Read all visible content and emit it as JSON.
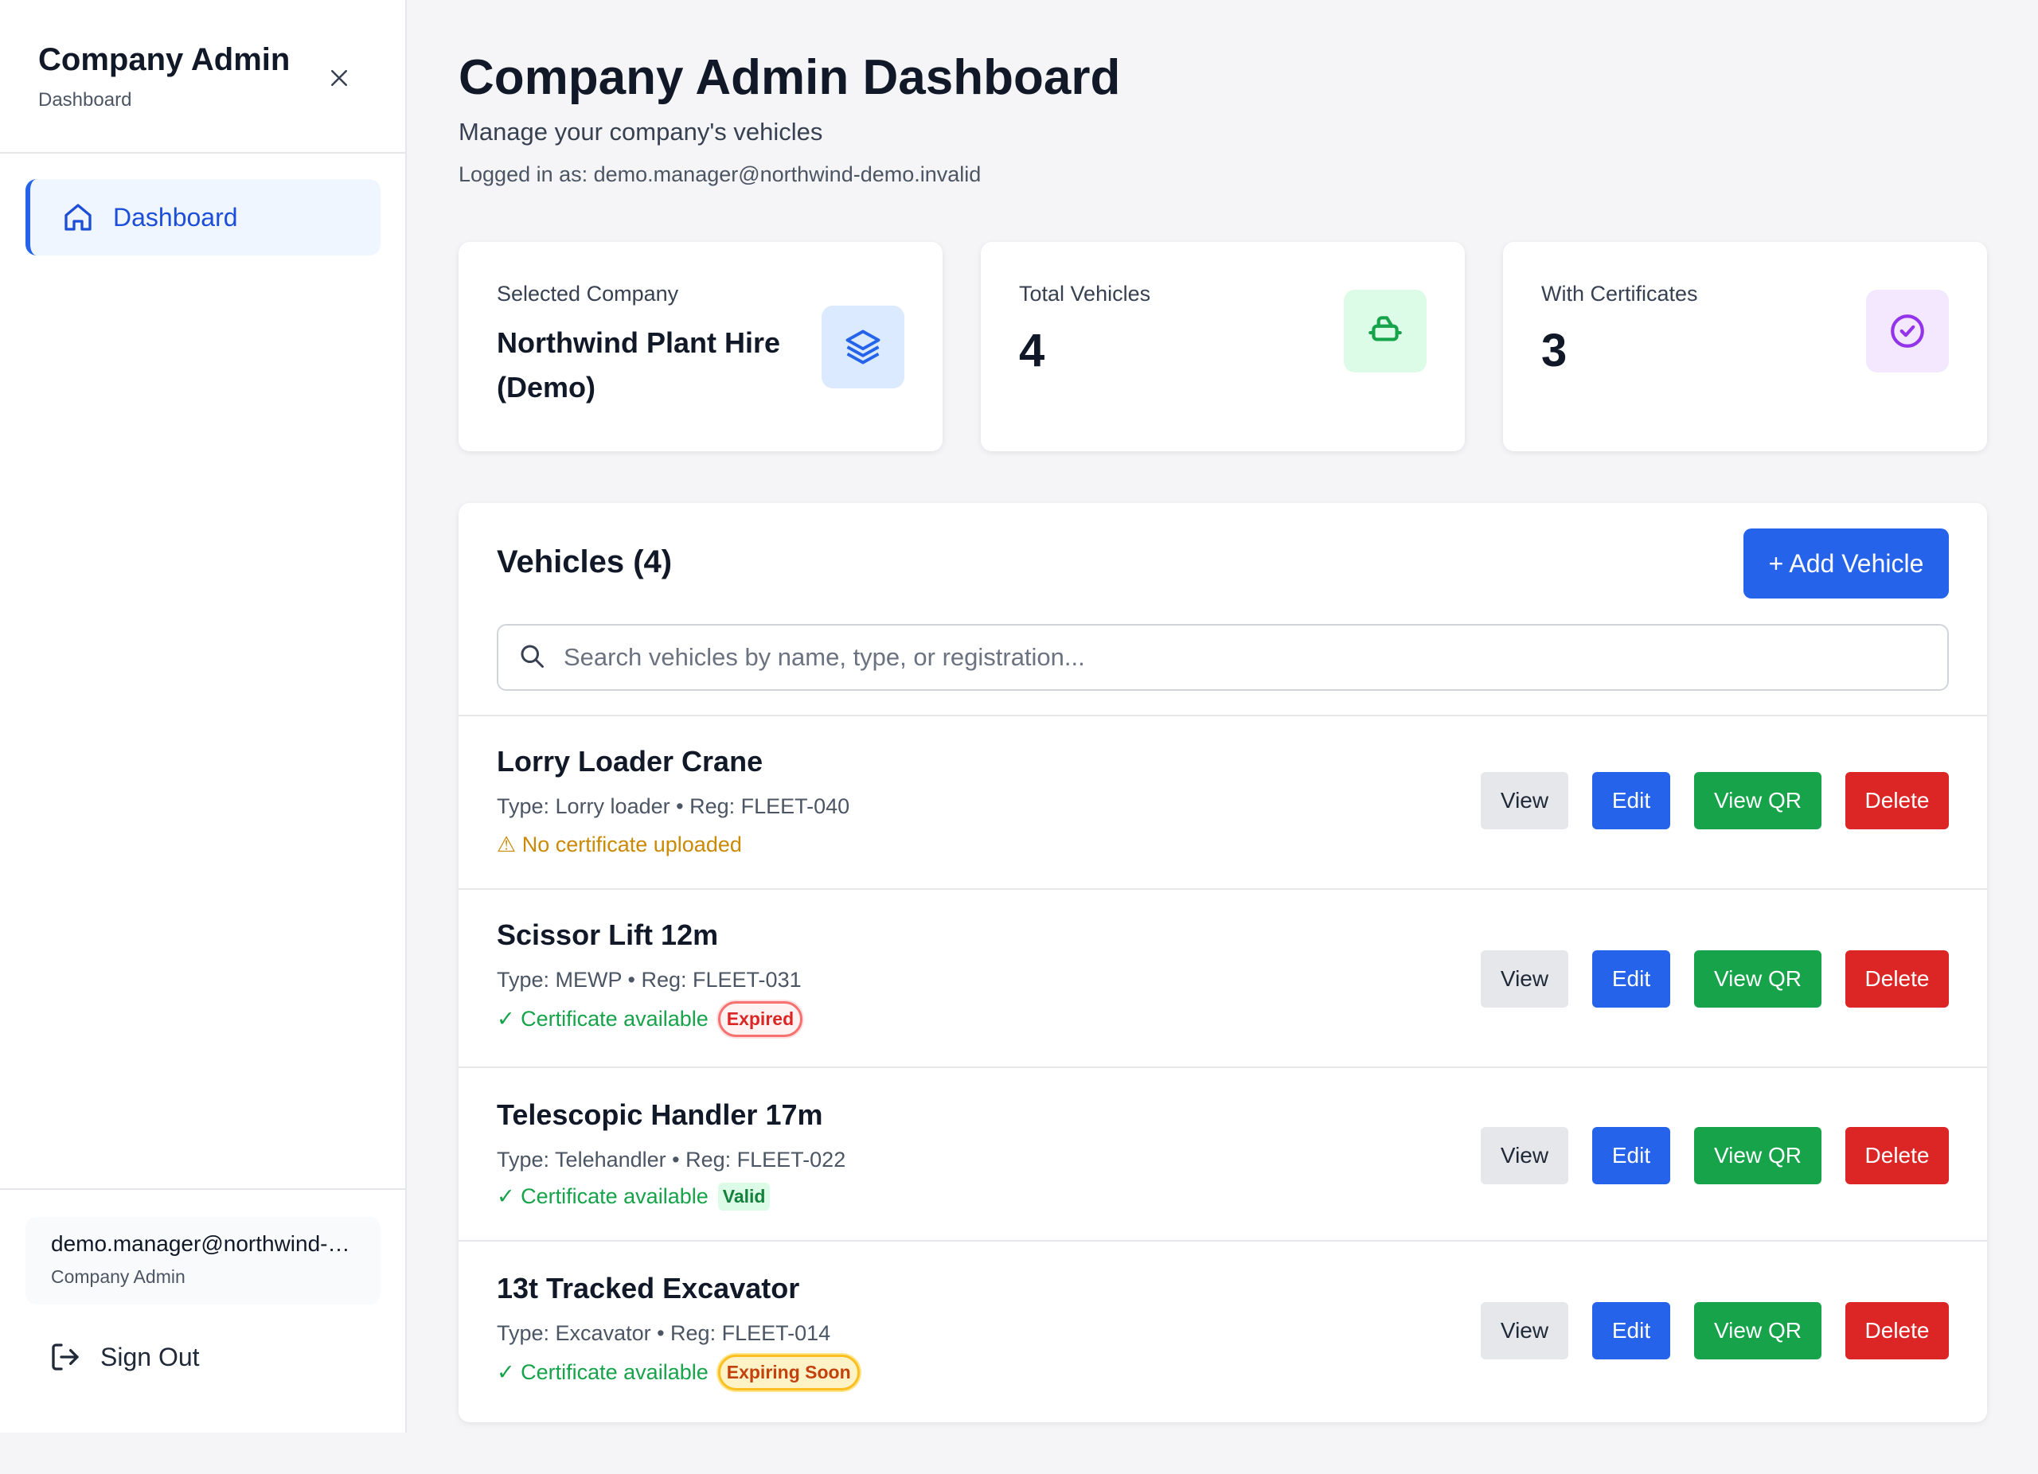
{
  "sidebar": {
    "title": "Company Admin",
    "subtitle": "Dashboard",
    "nav": [
      {
        "label": "Dashboard",
        "icon": "home-icon"
      }
    ],
    "user": {
      "email": "demo.manager@northwind-demo.invalid",
      "role": "Company Admin"
    },
    "signout_label": "Sign Out"
  },
  "header": {
    "title": "Company Admin Dashboard",
    "subtitle": "Manage your company's vehicles",
    "logged_in": "Logged in as: demo.manager@northwind-demo.invalid"
  },
  "stats": [
    {
      "label": "Selected Company",
      "value": "Northwind Plant Hire (Demo)",
      "icon": "layers-icon",
      "color": "#2563eb",
      "bg": "#dbeafe"
    },
    {
      "label": "Total Vehicles",
      "value": "4",
      "icon": "truck-icon",
      "color": "#16a34a",
      "bg": "#dcfce7"
    },
    {
      "label": "With Certificates",
      "value": "3",
      "icon": "check-circle-icon",
      "color": "#9333ea",
      "bg": "#f3e8ff"
    }
  ],
  "vehicles_section": {
    "title": "Vehicles (4)",
    "add_label": "+ Add Vehicle",
    "search_placeholder": "Search vehicles by name, type, or registration...",
    "search_value": "",
    "actions": {
      "view": "View",
      "edit": "Edit",
      "qr": "View QR",
      "delete": "Delete"
    },
    "items": [
      {
        "name": "Lorry Loader Crane",
        "meta": "Type: Lorry loader • Reg: FLEET-040",
        "status": "⚠ No certificate uploaded",
        "status_kind": "warn",
        "badge": ""
      },
      {
        "name": "Scissor Lift 12m",
        "meta": "Type: MEWP • Reg: FLEET-031",
        "status": "✓ Certificate available",
        "status_kind": "ok",
        "badge": "Expired"
      },
      {
        "name": "Telescopic Handler 17m",
        "meta": "Type: Telehandler • Reg: FLEET-022",
        "status": "✓ Certificate available",
        "status_kind": "ok",
        "badge": "Valid"
      },
      {
        "name": "13t Tracked Excavator",
        "meta": "Type: Excavator • Reg: FLEET-014",
        "status": "✓ Certificate available",
        "status_kind": "ok",
        "badge": "Expiring Soon"
      }
    ]
  },
  "colors": {
    "accent": "#2563eb",
    "success": "#16a34a",
    "danger": "#dc2626",
    "warning": "#ca8a04"
  }
}
